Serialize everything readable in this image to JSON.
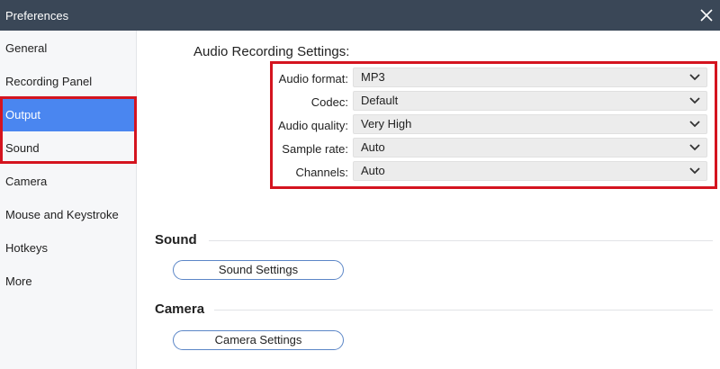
{
  "window": {
    "title": "Preferences",
    "close_icon": "close-icon"
  },
  "sidebar": {
    "items": [
      {
        "label": "General"
      },
      {
        "label": "Recording Panel"
      },
      {
        "label": "Output",
        "active": true
      },
      {
        "label": "Sound"
      },
      {
        "label": "Camera"
      },
      {
        "label": "Mouse and Keystroke"
      },
      {
        "label": "Hotkeys"
      },
      {
        "label": "More"
      }
    ],
    "active_color": "#4a86f0"
  },
  "audio": {
    "heading": "Audio Recording Settings:",
    "fields": [
      {
        "label": "Audio format:",
        "value": "MP3"
      },
      {
        "label": "Codec:",
        "value": "Default"
      },
      {
        "label": "Audio quality:",
        "value": "Very High"
      },
      {
        "label": "Sample rate:",
        "value": "Auto"
      },
      {
        "label": "Channels:",
        "value": "Auto"
      }
    ]
  },
  "sound": {
    "title": "Sound",
    "button": "Sound Settings"
  },
  "camera": {
    "title": "Camera",
    "button": "Camera Settings"
  },
  "highlight_color": "#d4141f"
}
